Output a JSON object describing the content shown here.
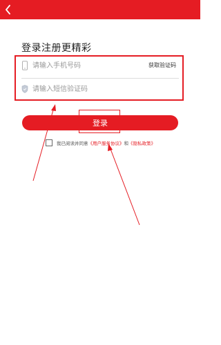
{
  "header": {
    "back_icon": "chevron-left-icon"
  },
  "page_title": "登录注册更精彩",
  "form": {
    "phone": {
      "icon": "phone-icon",
      "placeholder": "请输入手机号码",
      "value": "",
      "get_code_label": "获取验证码"
    },
    "sms_code": {
      "icon": "shield-icon",
      "placeholder": "请输入短信验证码",
      "value": ""
    }
  },
  "login_button_label": "登录",
  "agreement": {
    "checked": false,
    "prefix": "我已阅读并同意",
    "user_agreement": "《用户服务协议》",
    "and": "和",
    "privacy_policy": "《隐私政策》"
  },
  "colors": {
    "accent": "#e51c23",
    "annotation": "#e51c23"
  }
}
